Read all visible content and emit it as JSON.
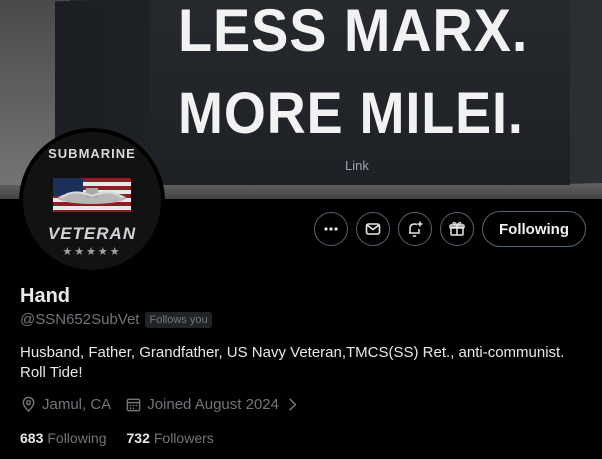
{
  "banner": {
    "line1": "LESS MARX.",
    "line2": "MORE MILEI.",
    "small": "Link"
  },
  "avatar": {
    "top": "SUBMARINE",
    "bottom": "VETERAN",
    "stars": "★★★★★"
  },
  "actions": {
    "more": "more-icon",
    "message": "envelope-icon",
    "notify": "bell-plus-icon",
    "gift": "gift-icon",
    "follow_label": "Following"
  },
  "profile": {
    "name": "Hand",
    "handle": "@SSN652SubVet",
    "follows_you": "Follows you",
    "bio": "Husband, Father, Grandfather, US Navy Veteran,TMCS(SS) Ret., anti-communist. Roll Tide!",
    "location": "Jamul, CA",
    "joined": "Joined August 2024"
  },
  "stats": {
    "following_count": "683",
    "following_label": "Following",
    "followers_count": "732",
    "followers_label": "Followers"
  },
  "colors": {
    "background": "#000000",
    "text": "#e7e9ea",
    "muted": "#71767b",
    "border": "#536471"
  }
}
